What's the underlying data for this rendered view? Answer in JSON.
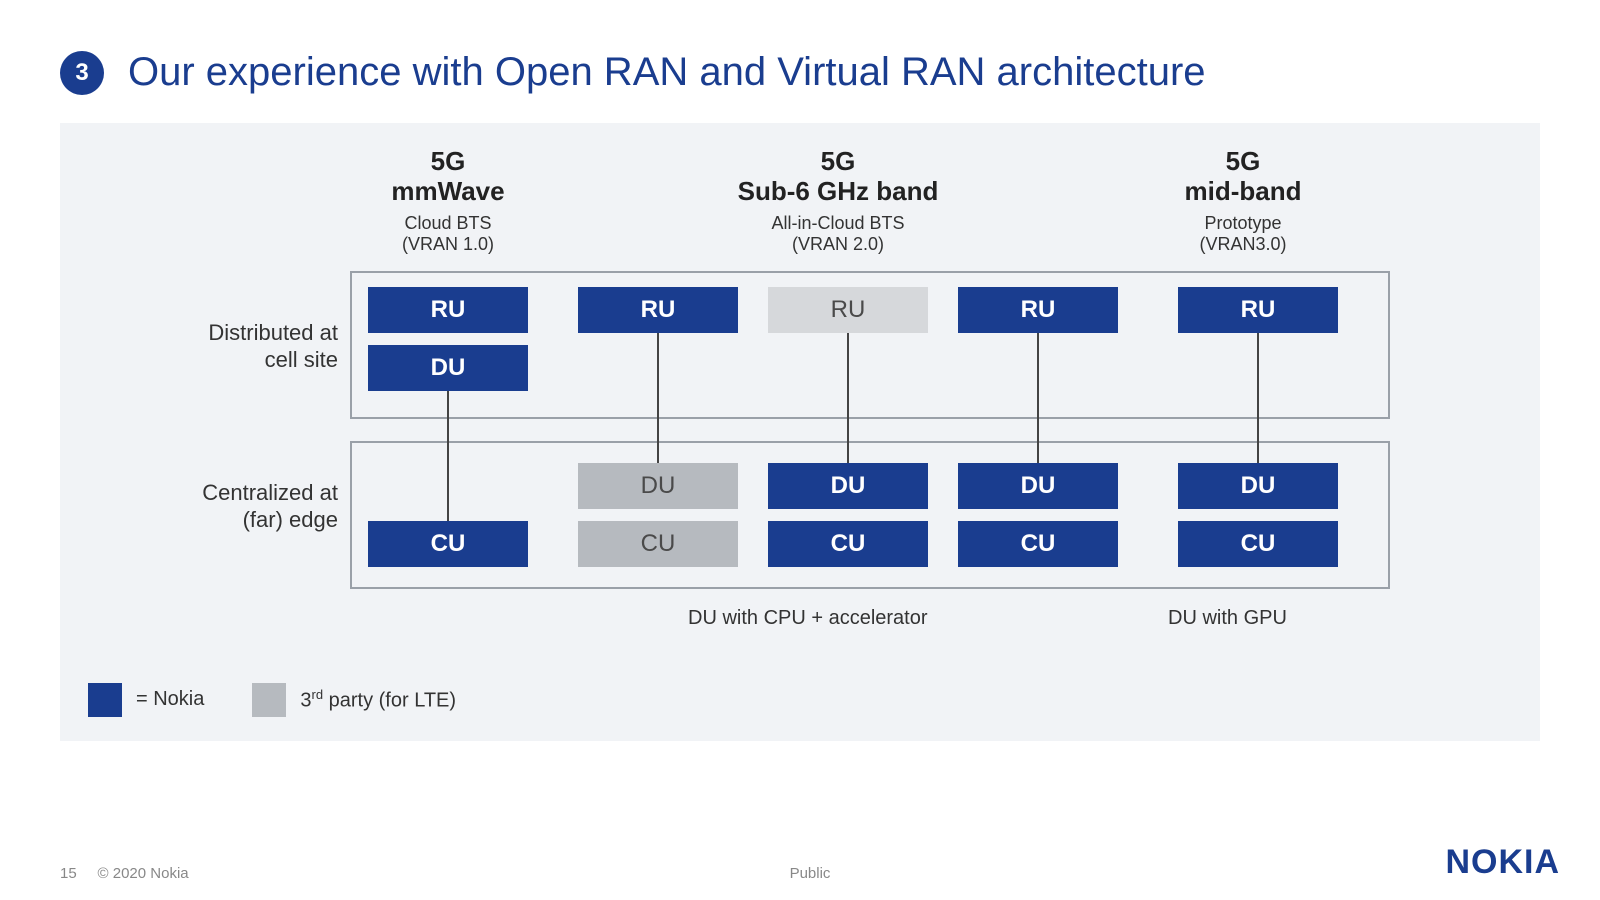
{
  "slide": {
    "badge": "3",
    "title": "Our experience with Open RAN and Virtual RAN architecture"
  },
  "columns": {
    "c1": {
      "line1": "5G",
      "line2": "mmWave",
      "sub1": "Cloud BTS",
      "sub2": "(VRAN 1.0)"
    },
    "c2": {
      "line1": "5G",
      "line2": "Sub-6 GHz band",
      "sub1": "All-in-Cloud BTS",
      "sub2": "(VRAN 2.0)"
    },
    "c3": {
      "line1": "5G",
      "line2": "mid-band",
      "sub1": "Prototype",
      "sub2": "(VRAN3.0)"
    }
  },
  "rowlabels": {
    "top1": "Distributed at",
    "top2": "cell site",
    "bot1": "Centralized at",
    "bot2": "(far) edge"
  },
  "boxes": {
    "ru": "RU",
    "du": "DU",
    "cu": "CU"
  },
  "footnotes": {
    "f1": "DU with CPU + accelerator",
    "f2": "DU with GPU"
  },
  "legend": {
    "nokia": "= Nokia",
    "third_pre": "3",
    "third_sup": "rd",
    "third_post": " party (for LTE)"
  },
  "footer": {
    "page": "15",
    "copyright": "© 2020 Nokia",
    "classification": "Public",
    "logo": "NOKIA"
  }
}
